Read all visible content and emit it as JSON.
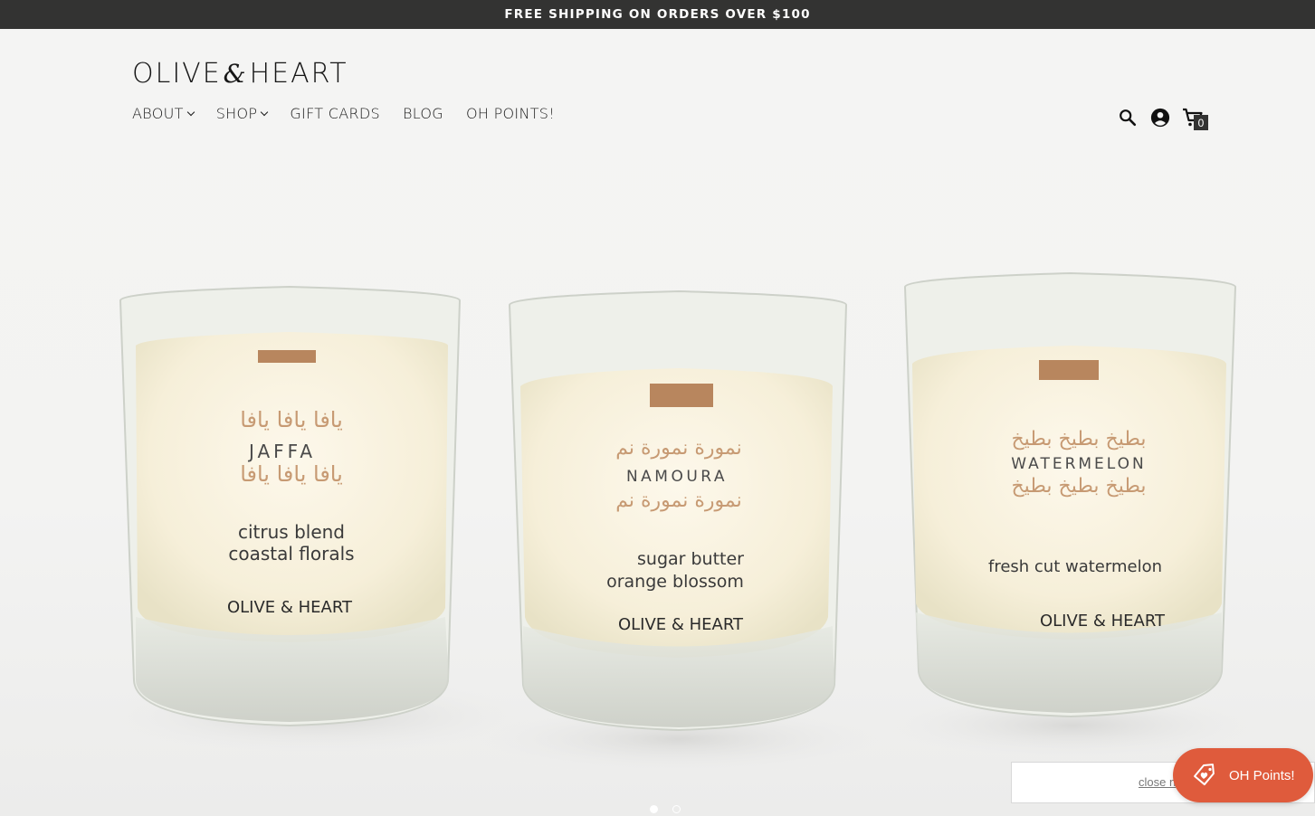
{
  "announcement": {
    "text": "FREE SHIPPING ON ORDERS OVER $100"
  },
  "header": {
    "logo": {
      "left": "OLIVE",
      "amp": "&",
      "right": "HEART"
    },
    "nav": [
      {
        "label": "ABOUT",
        "dropdown": true
      },
      {
        "label": "SHOP",
        "dropdown": true
      },
      {
        "label": "GIFT CARDS",
        "dropdown": false
      },
      {
        "label": "BLOG",
        "dropdown": false
      },
      {
        "label": "OH POINTS!",
        "dropdown": false
      }
    ],
    "icons": [
      "search-icon",
      "account-icon",
      "cart-icon"
    ],
    "cart_count": "0"
  },
  "hero": {
    "candles": [
      {
        "arabic": [
          "يافا يافا يافا",
          "يا",
          "يافا يافا يافا"
        ],
        "name": "JAFFA",
        "scent1": "citrus blend",
        "scent2": "coastal florals",
        "brand": "OLIVE & HEART"
      },
      {
        "arabic": [
          "نمورة نمورة نم",
          "نم",
          "نمورة نمورة نم"
        ],
        "name": "NAMOURA",
        "scent1": "sugar butter",
        "scent2": "orange blossom",
        "brand": "OLIVE & HEART"
      },
      {
        "arabic": [
          "بطيخ بطيخ بطيخ",
          "بط",
          "بطيخ بطيخ بطيخ"
        ],
        "name": "WATERMELON",
        "scent1": "fresh cut watermelon",
        "scent2": "",
        "brand": "OLIVE & HEART"
      }
    ],
    "slides": {
      "count": 2,
      "active": 1
    }
  },
  "rewards": {
    "close_text": "close n",
    "button_label": "OH Points!"
  },
  "colors": {
    "accent": "#df5b3c",
    "announcement_bg": "#333332",
    "label_text": "#c79a73"
  }
}
